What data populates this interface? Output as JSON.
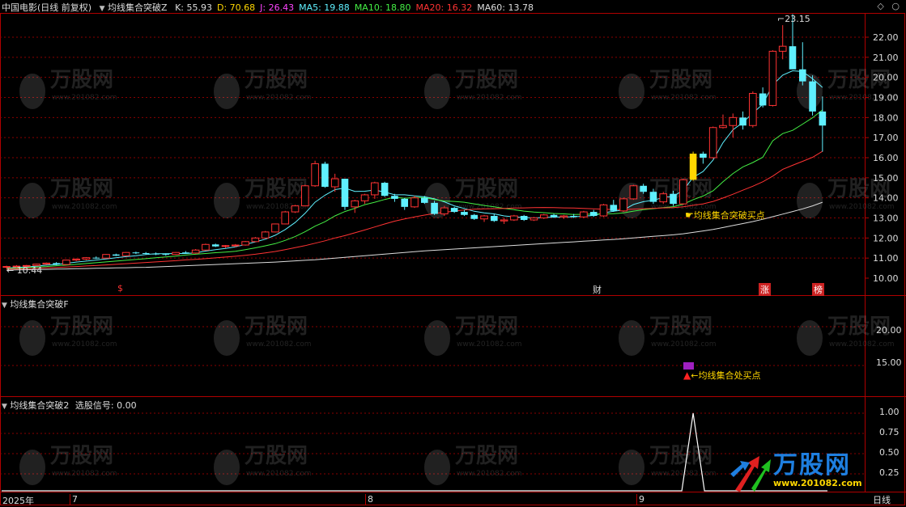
{
  "header": {
    "security": "中国电影(日线 前复权)",
    "formula": "均线集合突破Z",
    "items": [
      {
        "label": "K: 55.93",
        "color": "#dddddd"
      },
      {
        "label": "D: 70.68",
        "color": "#ffd700"
      },
      {
        "label": "J: 26.43",
        "color": "#ff44ff"
      },
      {
        "label": "MA5: 19.88",
        "color": "#5ff0ff"
      },
      {
        "label": "MA10: 18.80",
        "color": "#44ee44"
      },
      {
        "label": "MA20: 16.32",
        "color": "#ff3333"
      },
      {
        "label": "MA60: 13.78",
        "color": "#dddddd"
      }
    ]
  },
  "corner_icons": [
    "◇",
    "○"
  ],
  "main_panel": {
    "price_ticks": [
      "22.00",
      "21.00",
      "20.00",
      "19.00",
      "18.00",
      "17.00",
      "16.00",
      "15.00",
      "14.00",
      "13.00",
      "12.00",
      "11.00",
      "10.00"
    ],
    "high_label": "23.15",
    "low_label": "10.44",
    "buy_signal_label": "均线集合突破买点",
    "markers": [
      {
        "text": "$",
        "color": "#ff3333"
      },
      {
        "text": "财",
        "color": "#dddddd"
      },
      {
        "text": "涨",
        "color": "#ffffff",
        "bg": "#cc2222"
      },
      {
        "text": "榜",
        "color": "#ffffff",
        "bg": "#cc2222"
      }
    ]
  },
  "panel2": {
    "title": "均线集合突破F",
    "ticks": [
      "20.00",
      "15.00"
    ],
    "legend_label": "均线集合处买点"
  },
  "panel3": {
    "title": "均线集合突破2",
    "signal_label": "选股信号: 0.00",
    "ticks": [
      "1.00",
      "0.75",
      "0.50",
      "0.25"
    ]
  },
  "time_axis": {
    "labels": [
      "2025年",
      "7",
      "8",
      "9"
    ],
    "period": "日线"
  },
  "watermark": {
    "brand": "万股网",
    "url": "www.201082.com"
  },
  "colors": {
    "up": "#ff3333",
    "down": "#5ff0ff",
    "grid": "#8a0000",
    "border": "#b00000",
    "signal": "#ffd700"
  },
  "chart_data": {
    "type": "candlestick",
    "series": [
      {
        "name": "K",
        "ohlc": [
          [
            10.55,
            10.62,
            10.48,
            10.58
          ],
          [
            10.58,
            10.65,
            10.52,
            10.6
          ],
          [
            10.6,
            10.66,
            10.55,
            10.63
          ],
          [
            10.63,
            10.72,
            10.6,
            10.7
          ],
          [
            10.7,
            10.78,
            10.66,
            10.75
          ],
          [
            10.75,
            10.8,
            10.65,
            10.68
          ],
          [
            10.68,
            10.92,
            10.65,
            10.9
          ],
          [
            10.9,
            10.98,
            10.85,
            10.95
          ],
          [
            10.95,
            11.05,
            10.9,
            11.02
          ],
          [
            11.02,
            11.08,
            10.96,
            11.0
          ],
          [
            11.0,
            11.2,
            10.98,
            11.18
          ],
          [
            11.18,
            11.22,
            11.1,
            11.12
          ],
          [
            11.12,
            11.3,
            11.1,
            11.28
          ],
          [
            11.28,
            11.32,
            11.2,
            11.25
          ],
          [
            11.25,
            11.3,
            11.18,
            11.22
          ],
          [
            11.22,
            11.28,
            11.15,
            11.2
          ],
          [
            11.2,
            11.24,
            11.12,
            11.18
          ],
          [
            11.18,
            11.3,
            11.15,
            11.28
          ],
          [
            11.28,
            11.35,
            11.22,
            11.25
          ],
          [
            11.25,
            11.45,
            11.22,
            11.4
          ],
          [
            11.4,
            11.72,
            11.38,
            11.68
          ],
          [
            11.68,
            11.72,
            11.55,
            11.58
          ],
          [
            11.58,
            11.65,
            11.5,
            11.62
          ],
          [
            11.62,
            11.7,
            11.55,
            11.65
          ],
          [
            11.65,
            11.85,
            11.62,
            11.82
          ],
          [
            11.82,
            12.05,
            11.8,
            12.0
          ],
          [
            12.0,
            12.35,
            11.98,
            12.3
          ],
          [
            12.3,
            12.72,
            12.28,
            12.7
          ],
          [
            12.7,
            13.35,
            12.68,
            13.3
          ],
          [
            13.3,
            13.65,
            13.25,
            13.6
          ],
          [
            13.6,
            14.65,
            13.58,
            14.6
          ],
          [
            14.6,
            15.85,
            14.55,
            15.7
          ],
          [
            15.7,
            15.8,
            14.5,
            14.55
          ],
          [
            14.55,
            15.2,
            14.3,
            14.95
          ],
          [
            14.95,
            14.95,
            13.4,
            13.55
          ],
          [
            13.55,
            13.9,
            13.25,
            13.85
          ],
          [
            13.85,
            14.2,
            13.7,
            14.15
          ],
          [
            14.15,
            14.8,
            13.95,
            14.75
          ],
          [
            14.75,
            14.8,
            14.05,
            14.1
          ],
          [
            14.1,
            14.2,
            13.8,
            13.95
          ],
          [
            13.95,
            14.0,
            13.4,
            13.55
          ],
          [
            13.55,
            14.1,
            13.5,
            14.0
          ],
          [
            14.0,
            14.1,
            13.7,
            13.75
          ],
          [
            13.75,
            13.85,
            13.15,
            13.2
          ],
          [
            13.2,
            13.6,
            13.1,
            13.5
          ],
          [
            13.5,
            13.55,
            13.25,
            13.3
          ],
          [
            13.3,
            13.4,
            13.1,
            13.15
          ],
          [
            13.15,
            13.2,
            12.9,
            12.95
          ],
          [
            12.95,
            13.15,
            12.8,
            13.1
          ],
          [
            13.1,
            13.2,
            12.8,
            12.85
          ],
          [
            12.85,
            13.0,
            12.7,
            12.9
          ],
          [
            12.9,
            13.15,
            12.85,
            13.1
          ],
          [
            13.1,
            13.15,
            12.85,
            12.9
          ],
          [
            12.9,
            13.05,
            12.85,
            13.0
          ],
          [
            13.0,
            13.2,
            12.95,
            13.15
          ],
          [
            13.15,
            13.2,
            13.0,
            13.05
          ],
          [
            13.05,
            13.15,
            12.95,
            13.1
          ],
          [
            13.1,
            13.2,
            13.0,
            13.05
          ],
          [
            13.05,
            13.35,
            13.0,
            13.3
          ],
          [
            13.3,
            13.4,
            13.05,
            13.1
          ],
          [
            13.1,
            13.7,
            13.05,
            13.65
          ],
          [
            13.65,
            13.9,
            13.3,
            13.35
          ],
          [
            13.35,
            14.0,
            13.3,
            13.95
          ],
          [
            13.95,
            14.65,
            13.9,
            14.6
          ],
          [
            14.6,
            14.7,
            14.2,
            14.3
          ],
          [
            14.3,
            14.45,
            13.7,
            13.8
          ],
          [
            13.8,
            14.3,
            13.7,
            14.2
          ],
          [
            14.2,
            14.35,
            13.6,
            13.7
          ],
          [
            13.7,
            14.95,
            13.65,
            14.9
          ],
          [
            14.9,
            16.3,
            14.85,
            16.2
          ],
          [
            16.2,
            16.3,
            15.7,
            16.0
          ],
          [
            16.0,
            17.55,
            15.95,
            17.5
          ],
          [
            17.5,
            18.15,
            17.45,
            17.6
          ],
          [
            17.6,
            18.2,
            17.0,
            18.0
          ],
          [
            18.0,
            18.3,
            17.4,
            17.6
          ],
          [
            17.6,
            19.3,
            17.5,
            19.2
          ],
          [
            19.2,
            19.5,
            18.5,
            18.6
          ],
          [
            18.6,
            21.35,
            18.55,
            21.3
          ],
          [
            21.3,
            22.6,
            20.9,
            21.55
          ],
          [
            21.55,
            23.15,
            20.4,
            20.4
          ],
          [
            20.4,
            21.75,
            19.6,
            19.8
          ],
          [
            19.8,
            20.1,
            18.1,
            18.3
          ],
          [
            18.3,
            19.05,
            16.3,
            17.6
          ]
        ]
      },
      {
        "name": "MA5",
        "values": [
          10.5,
          10.53,
          10.56,
          10.6,
          10.65,
          10.68,
          10.74,
          10.8,
          10.85,
          10.9,
          10.96,
          11.02,
          11.07,
          11.12,
          11.18,
          11.22,
          11.22,
          11.23,
          11.23,
          11.26,
          11.35,
          11.42,
          11.48,
          11.56,
          11.68,
          11.81,
          11.94,
          12.14,
          12.42,
          12.77,
          13.23,
          13.78,
          14.13,
          14.41,
          14.49,
          14.32,
          14.33,
          14.39,
          14.29,
          14.15,
          14.15,
          14.1,
          14.05,
          13.95,
          13.8,
          13.6,
          13.47,
          13.33,
          13.25,
          13.2,
          13.1,
          13.05,
          13.02,
          13.0,
          13.02,
          13.04,
          13.05,
          13.05,
          13.09,
          13.12,
          13.25,
          13.33,
          13.4,
          13.67,
          13.81,
          13.88,
          14.02,
          14.08,
          14.37,
          15.02,
          15.31,
          15.88,
          16.75,
          17.39,
          17.75,
          18.22,
          18.66,
          19.63,
          20.11,
          20.33,
          20.29,
          19.93,
          19.5
        ]
      },
      {
        "name": "MA10",
        "values": [
          10.48,
          10.5,
          10.52,
          10.55,
          10.58,
          10.62,
          10.65,
          10.69,
          10.73,
          10.77,
          10.81,
          10.85,
          10.89,
          10.93,
          10.97,
          11.02,
          11.06,
          11.1,
          11.15,
          11.19,
          11.23,
          11.27,
          11.3,
          11.34,
          11.42,
          11.51,
          11.61,
          11.72,
          11.88,
          12.07,
          12.31,
          12.59,
          12.81,
          13.1,
          13.32,
          13.48,
          13.66,
          13.78,
          13.92,
          14.03,
          13.98,
          14.02,
          14.02,
          13.92,
          13.84,
          13.82,
          13.78,
          13.7,
          13.62,
          13.55,
          13.47,
          13.41,
          13.34,
          13.29,
          13.26,
          13.22,
          13.2,
          13.17,
          13.18,
          13.19,
          13.2,
          13.21,
          13.25,
          13.34,
          13.41,
          13.46,
          13.51,
          13.56,
          13.68,
          13.91,
          14.09,
          14.35,
          14.8,
          15.21,
          15.54,
          15.76,
          16.02,
          16.84,
          17.2,
          17.36,
          17.67,
          17.99,
          18.38
        ]
      },
      {
        "name": "MA20",
        "values": [
          10.45,
          10.46,
          10.47,
          10.49,
          10.51,
          10.53,
          10.55,
          10.58,
          10.61,
          10.63,
          10.66,
          10.69,
          10.72,
          10.75,
          10.78,
          10.81,
          10.84,
          10.87,
          10.91,
          10.94,
          10.97,
          11.01,
          11.05,
          11.09,
          11.14,
          11.19,
          11.26,
          11.33,
          11.42,
          11.52,
          11.62,
          11.74,
          11.86,
          12.0,
          12.12,
          12.26,
          12.4,
          12.55,
          12.7,
          12.84,
          12.95,
          13.05,
          13.14,
          13.22,
          13.28,
          13.34,
          13.4,
          13.43,
          13.45,
          13.46,
          13.47,
          13.49,
          13.5,
          13.51,
          13.52,
          13.51,
          13.5,
          13.49,
          13.47,
          13.45,
          13.43,
          13.42,
          13.42,
          13.44,
          13.46,
          13.48,
          13.5,
          13.51,
          13.55,
          13.63,
          13.7,
          13.82,
          13.99,
          14.18,
          14.38,
          14.58,
          14.8,
          15.08,
          15.42,
          15.62,
          15.82,
          16.02,
          16.32
        ]
      },
      {
        "name": "MA60",
        "values": [
          10.4,
          10.41,
          10.42,
          10.43,
          10.44,
          10.45,
          10.46,
          10.47,
          10.48,
          10.49,
          10.5,
          10.51,
          10.52,
          10.53,
          10.54,
          10.56,
          10.58,
          10.6,
          10.62,
          10.64,
          10.66,
          10.68,
          10.7,
          10.72,
          10.74,
          10.76,
          10.78,
          10.8,
          10.83,
          10.86,
          10.89,
          10.92,
          10.96,
          11.0,
          11.04,
          11.08,
          11.12,
          11.16,
          11.2,
          11.24,
          11.28,
          11.32,
          11.36,
          11.39,
          11.42,
          11.45,
          11.48,
          11.51,
          11.54,
          11.57,
          11.6,
          11.63,
          11.66,
          11.69,
          11.72,
          11.75,
          11.78,
          11.81,
          11.84,
          11.87,
          11.9,
          11.93,
          11.96,
          12.0,
          12.04,
          12.08,
          12.12,
          12.16,
          12.21,
          12.28,
          12.35,
          12.43,
          12.52,
          12.62,
          12.72,
          12.82,
          12.93,
          13.06,
          13.19,
          13.32,
          13.45,
          13.6,
          13.78
        ]
      }
    ],
    "signal_index": 69,
    "panel3_signal": {
      "peak_index": 69,
      "peak_value": 1.0
    },
    "ylim": [
      9.9,
      22.6
    ]
  }
}
